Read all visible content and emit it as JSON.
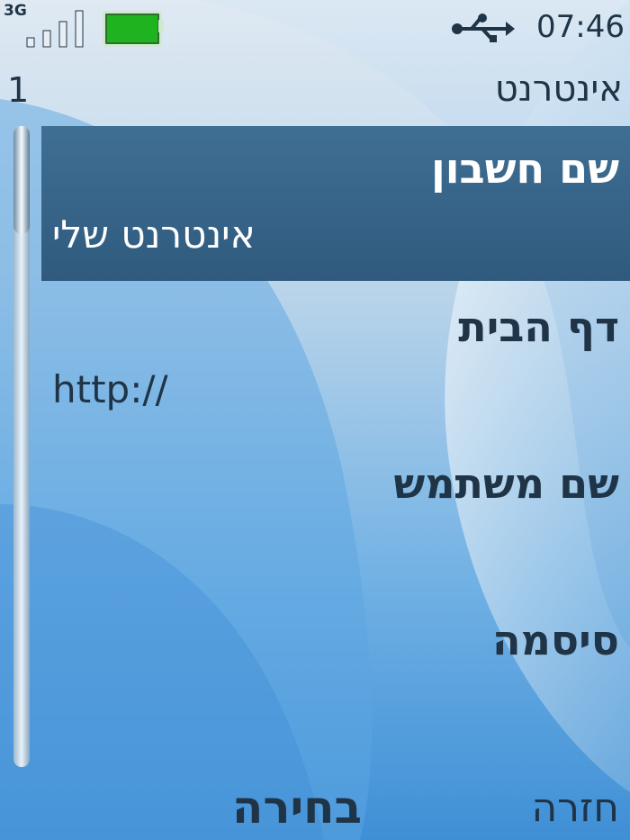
{
  "status": {
    "network_type": "3G",
    "signal_bars": 4,
    "battery_level": 1.0,
    "usb_connected": true,
    "time": "07:46"
  },
  "header": {
    "page_number": "1",
    "title": "אינטרנט"
  },
  "list": {
    "items": [
      {
        "label": "שם חשבון",
        "value": "אינטרנט שלי",
        "selected": true
      },
      {
        "label": "דף הבית",
        "value": "http://",
        "selected": false
      },
      {
        "label": "שם משתמש",
        "value": "",
        "selected": false
      },
      {
        "label": "סיסמה",
        "value": "",
        "selected": false
      }
    ]
  },
  "softkeys": {
    "back": "חזרה",
    "select": "בחירה"
  },
  "colors": {
    "text": "#1f3447",
    "highlight": "#2f5a7e",
    "battery": "#1fb41f"
  },
  "icons": [
    "usb-icon",
    "signal-icon",
    "battery-icon"
  ]
}
